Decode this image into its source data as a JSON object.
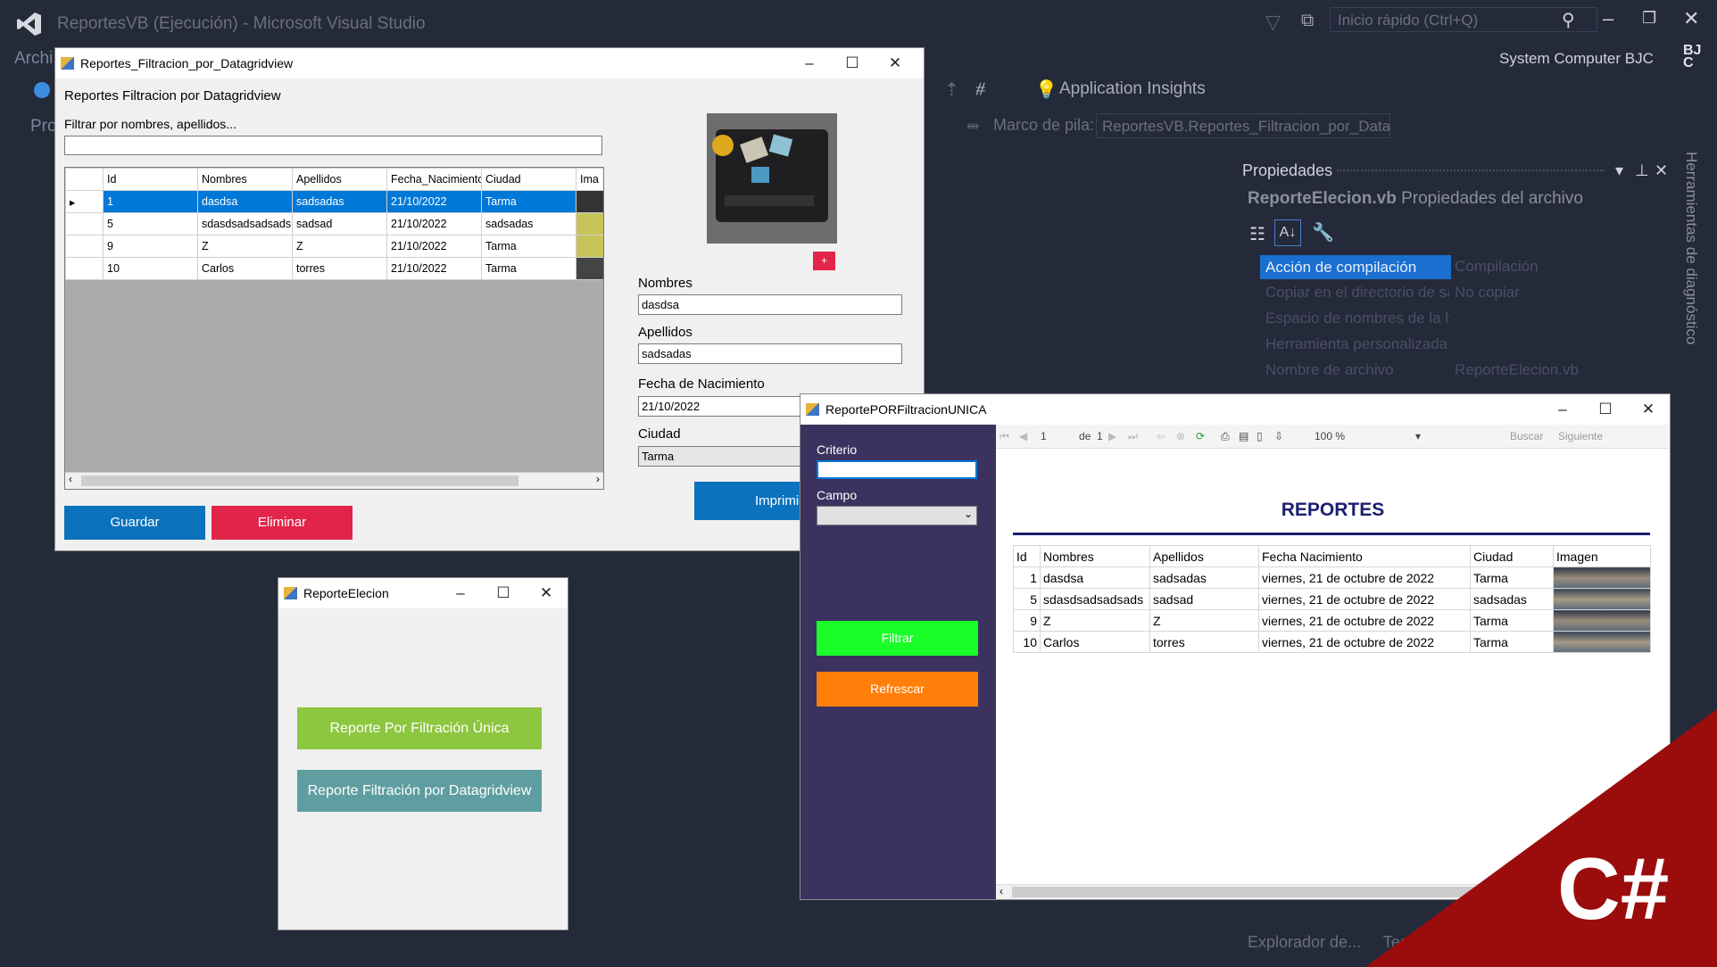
{
  "vs": {
    "title": "ReportesVB (Ejecución) - Microsoft Visual Studio",
    "menu_fragment": "Archi",
    "toolbar_fragment": "Pro",
    "quick_launch": "Inicio rápido (Ctrl+Q)",
    "user": "System Computer BJC",
    "user_initials": "BJC",
    "app_insights": "Application Insights",
    "frame_label": "Marco de pila:",
    "frame_value": "ReportesVB.Reportes_Filtracion_por_Datag",
    "properties": {
      "title": "Propiedades",
      "file_name": "ReporteElecion.vb",
      "file_desc": "Propiedades del archivo",
      "rows": [
        {
          "name": "Acción de compilación",
          "value": "Compilación"
        },
        {
          "name": "Copiar en el directorio de sa",
          "value": "No copiar"
        },
        {
          "name": "Espacio de nombres de la he",
          "value": ""
        },
        {
          "name": "Herramienta personalizada",
          "value": ""
        },
        {
          "name": "Nombre de archivo",
          "value": "ReporteElecion.vb"
        }
      ]
    },
    "diag_vertical": "Herramientas de diagnóstico",
    "bottom_tabs": "Explorador de...     Team"
  },
  "win1": {
    "title": "Reportes_Filtracion_por_Datagridview",
    "heading": "Reportes Filtracion por Datagridview",
    "filter_label": "Filtrar por nombres, apellidos...",
    "filter_value": "",
    "columns": [
      "Id",
      "Nombres",
      "Apellidos",
      "Fecha_Nacimiento",
      "Ciudad",
      "Ima"
    ],
    "rows": [
      [
        "1",
        "dasdsa",
        "sadsadas",
        "21/10/2022",
        "Tarma"
      ],
      [
        "5",
        "sdasdsadsadsads",
        "sadsad",
        "21/10/2022",
        "sadsadas"
      ],
      [
        "9",
        "Z",
        "Z",
        "21/10/2022",
        "Tarma"
      ],
      [
        "10",
        "Carlos",
        "torres",
        "21/10/2022",
        "Tarma"
      ]
    ],
    "nombres_label": "Nombres",
    "nombres_value": "dasdsa",
    "apellidos_label": "Apellidos",
    "apellidos_value": "sadsadas",
    "fecha_label": "Fecha de Nacimiento",
    "fecha_value": "21/10/2022",
    "ciudad_label": "Ciudad",
    "ciudad_value": "Tarma",
    "add_image": "+",
    "btn_guardar": "Guardar",
    "btn_eliminar": "Eliminar",
    "btn_imprimir": "Imprimir",
    "colors": {
      "guardar": "#0b72bd",
      "eliminar": "#e3244a",
      "selected": "#0078d7"
    }
  },
  "win2": {
    "title": "ReporteElecion",
    "btn_unica": "Reporte Por Filtración Única",
    "btn_grid": "Reporte Filtración por Datagridview",
    "colors": {
      "unica": "#8dc63f",
      "grid": "#5f9ea0"
    }
  },
  "win3": {
    "title": "ReportePORFiltracionUNICA",
    "criterio_label": "Criterio",
    "campo_label": "Campo",
    "btn_filtrar": "Filtrar",
    "btn_refrescar": "Refrescar",
    "toolbar": {
      "page": "1",
      "of": "de",
      "total": "1",
      "zoom": "100 %",
      "find": "Buscar",
      "next": "Siguiente"
    },
    "report_title": "REPORTES",
    "columns": [
      "Id",
      "Nombres",
      "Apellidos",
      "Fecha Nacimiento",
      "Ciudad",
      "Imagen"
    ],
    "rows": [
      [
        "1",
        "dasdsa",
        "sadsadas",
        "viernes, 21 de octubre de 2022",
        "Tarma"
      ],
      [
        "5",
        "sdasdsadsadsads",
        "sadsad",
        "viernes, 21 de octubre de 2022",
        "sadsadas"
      ],
      [
        "9",
        "Z",
        "Z",
        "viernes, 21 de octubre de 2022",
        "Tarma"
      ],
      [
        "10",
        "Carlos",
        "torres",
        "viernes, 21 de octubre de 2022",
        "Tarma"
      ]
    ],
    "colors": {
      "sidebar": "#3c325f",
      "filtrar": "#1aff2a",
      "refrescar": "#ff7f0a",
      "title": "#1c1f6e"
    }
  },
  "badge": {
    "text": "C#",
    "color": "#9b0d0d"
  }
}
